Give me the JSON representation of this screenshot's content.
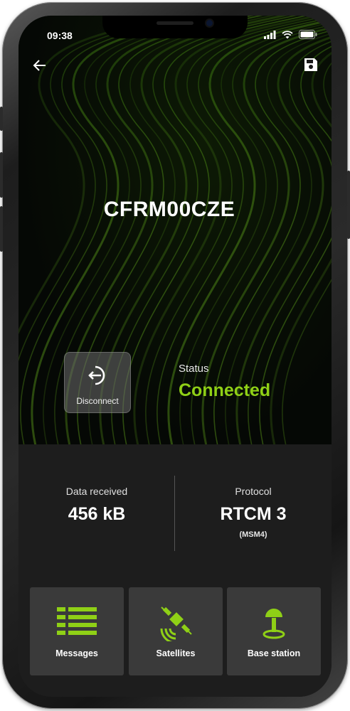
{
  "status_bar": {
    "time": "09:38"
  },
  "toolbar": {
    "back_icon": "arrow-left-icon",
    "save_icon": "floppy-disk-icon"
  },
  "device": {
    "name": "CFRM00CZE"
  },
  "disconnect": {
    "label": "Disconnect",
    "icon": "exit-arrow-icon"
  },
  "status": {
    "label": "Status",
    "value": "Connected",
    "value_color": "#8fd016"
  },
  "stats": {
    "data_received": {
      "label": "Data received",
      "value": "456 kB"
    },
    "protocol": {
      "label": "Protocol",
      "value": "RTCM 3",
      "sub": "(MSM4)"
    }
  },
  "tiles": [
    {
      "label": "Messages",
      "icon": "list-icon"
    },
    {
      "label": "Satellites",
      "icon": "satellite-icon"
    },
    {
      "label": "Base station",
      "icon": "base-station-icon"
    }
  ],
  "colors": {
    "accent": "#8fd016",
    "panel": "#1d1d1d",
    "tile": "#3a3a3a"
  }
}
